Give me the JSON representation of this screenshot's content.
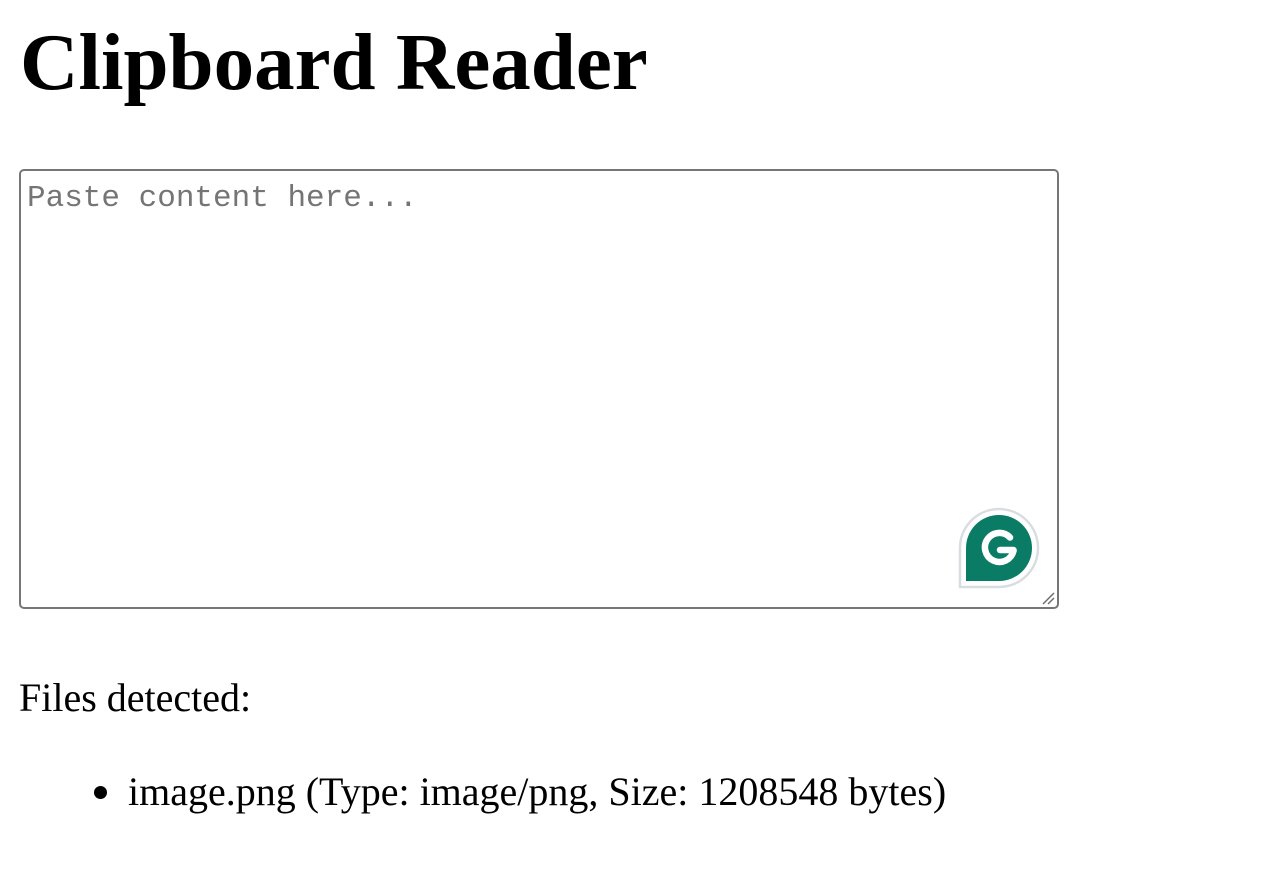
{
  "page": {
    "title": "Clipboard Reader"
  },
  "paste_box": {
    "placeholder": "Paste content here...",
    "value": "",
    "extension_icon": "grammarly-icon"
  },
  "files": {
    "label": "Files detected:",
    "items": [
      {
        "text": "image.png (Type: image/png, Size: 1208548 bytes)"
      }
    ]
  },
  "colors": {
    "border": "#767676",
    "placeholder": "#757575",
    "grammarly_green": "#0a7c66",
    "text": "#000000"
  }
}
